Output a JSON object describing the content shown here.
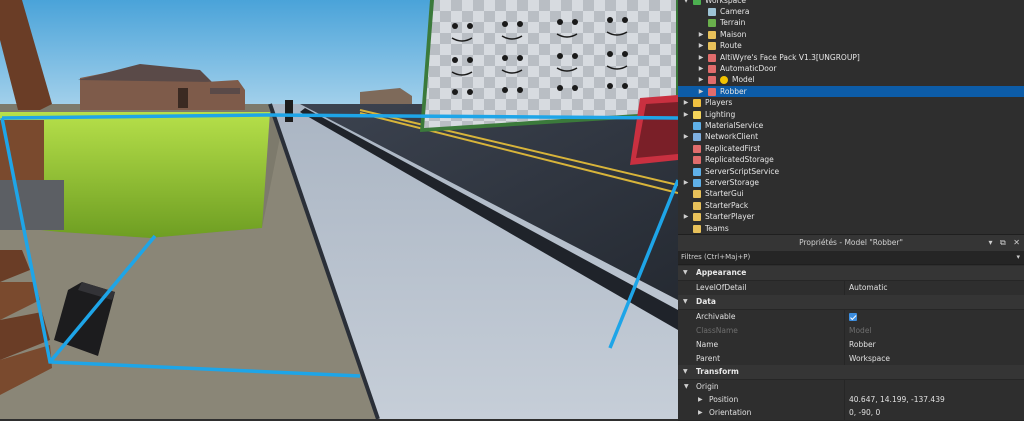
{
  "explorer": {
    "items": [
      {
        "label": "Workspace",
        "icon": "workspace-icon",
        "color": "#4caf50",
        "arrow": "expanded",
        "selected": false
      },
      {
        "label": "Camera",
        "icon": "camera-icon",
        "color": "#9ec4d6",
        "arrow": "none",
        "selected": false
      },
      {
        "label": "Terrain",
        "icon": "terrain-icon",
        "color": "#6ab04c",
        "arrow": "none",
        "selected": false
      },
      {
        "label": "Maison",
        "icon": "folder-icon",
        "color": "#e8c15a",
        "arrow": "collapsed",
        "selected": false
      },
      {
        "label": "Route",
        "icon": "folder-icon",
        "color": "#e8c15a",
        "arrow": "collapsed",
        "selected": false
      },
      {
        "label": "AltiWyre's Face Pack  V1.3[UNGROUP]",
        "icon": "model-icon",
        "color": "#e06c6c",
        "arrow": "collapsed",
        "selected": false
      },
      {
        "label": "AutomaticDoor",
        "icon": "model-icon",
        "color": "#e06c6c",
        "arrow": "collapsed",
        "selected": false
      },
      {
        "label": "Model",
        "icon": "model-icon",
        "color": "#e06c6c",
        "arrow": "collapsed",
        "selected": false,
        "extra_icon": "smiley-icon"
      },
      {
        "label": "Robber",
        "icon": "model-icon",
        "color": "#e06c6c",
        "arrow": "collapsed",
        "selected": true
      },
      {
        "label": "Players",
        "icon": "players-icon",
        "color": "#f0c040",
        "arrow": "collapsed",
        "selected": false
      },
      {
        "label": "Lighting",
        "icon": "lighting-icon",
        "color": "#f5d45a",
        "arrow": "collapsed",
        "selected": false
      },
      {
        "label": "MaterialService",
        "icon": "material-service-icon",
        "color": "#5fb0e8",
        "arrow": "none",
        "selected": false
      },
      {
        "label": "NetworkClient",
        "icon": "network-icon",
        "color": "#7fb0e0",
        "arrow": "collapsed",
        "selected": false
      },
      {
        "label": "ReplicatedFirst",
        "icon": "replicated-first-icon",
        "color": "#e06c6c",
        "arrow": "none",
        "selected": false
      },
      {
        "label": "ReplicatedStorage",
        "icon": "replicated-storage-icon",
        "color": "#e06c6c",
        "arrow": "none",
        "selected": false
      },
      {
        "label": "ServerScriptService",
        "icon": "server-script-service-icon",
        "color": "#5fb0e8",
        "arrow": "none",
        "selected": false
      },
      {
        "label": "ServerStorage",
        "icon": "server-storage-icon",
        "color": "#5fb0e8",
        "arrow": "collapsed",
        "selected": false
      },
      {
        "label": "StarterGui",
        "icon": "starter-gui-icon",
        "color": "#e8c15a",
        "arrow": "none",
        "selected": false
      },
      {
        "label": "StarterPack",
        "icon": "starter-pack-icon",
        "color": "#e8c15a",
        "arrow": "none",
        "selected": false
      },
      {
        "label": "StarterPlayer",
        "icon": "starter-player-icon",
        "color": "#e8c15a",
        "arrow": "collapsed",
        "selected": false
      },
      {
        "label": "Teams",
        "icon": "teams-icon",
        "color": "#e8c15a",
        "arrow": "none",
        "selected": false
      }
    ]
  },
  "properties": {
    "title": "Propriétés - Model \"Robber\"",
    "filter_placeholder": "Filtres (Ctrl+Maj+P)",
    "categories": {
      "appearance": "Appearance",
      "data": "Data",
      "transform": "Transform"
    },
    "rows": {
      "level_of_detail": {
        "name": "LevelOfDetail",
        "value": "Automatic"
      },
      "archivable": {
        "name": "Archivable",
        "checked": true
      },
      "class_name": {
        "name": "ClassName",
        "value": "Model"
      },
      "name": {
        "name": "Name",
        "value": "Robber"
      },
      "parent": {
        "name": "Parent",
        "value": "Workspace"
      },
      "origin": {
        "name": "Origin"
      },
      "position": {
        "name": "Position",
        "value": "40.647, 14.199, -137.439"
      },
      "orientation": {
        "name": "Orientation",
        "value": "0, -90, 0"
      }
    }
  },
  "colors": {
    "selection": "#0c5ca8",
    "selection_box": "#1ea5e8",
    "checkbox": "#3c8dde"
  }
}
